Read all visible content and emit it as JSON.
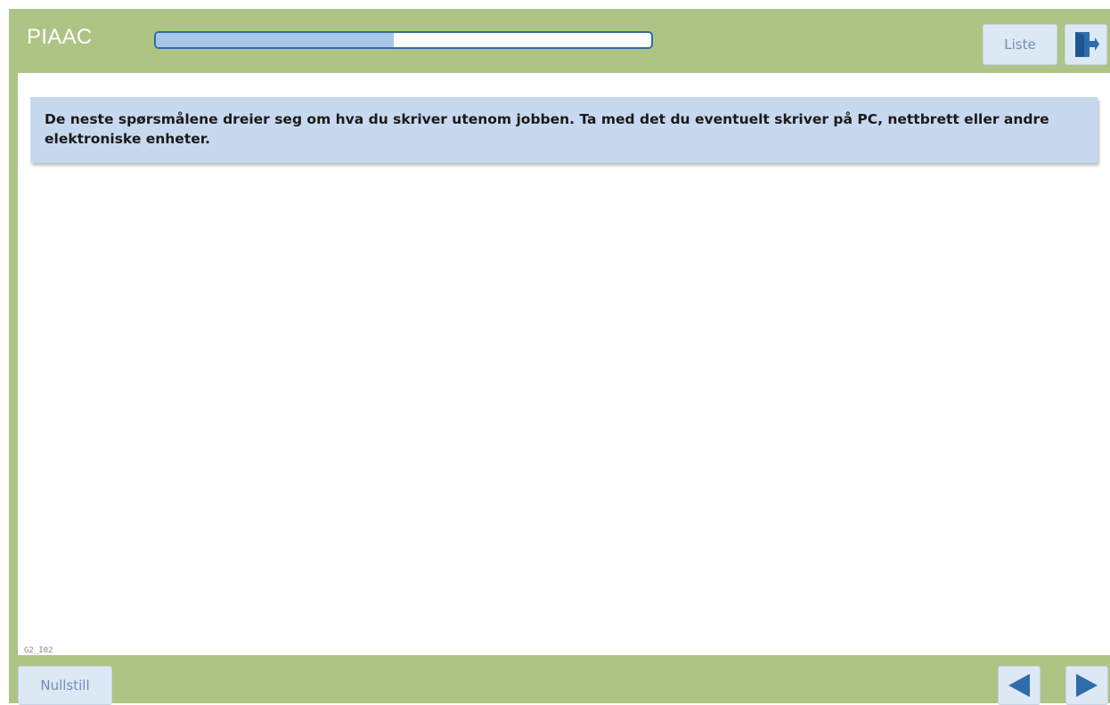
{
  "header": {
    "title": "PIAAC",
    "progress": 0.48,
    "list_label": "Liste",
    "exit_icon": "exit-door-icon"
  },
  "main": {
    "info_text": "De neste spørsmålene dreier seg om hva du skriver utenom jobben. Ta med det du eventuelt skriver på PC, nettbrett eller andre elektroniske enheter.",
    "page_code": "G2_I02"
  },
  "footer": {
    "reset_label": "Nullstill",
    "back_icon": "triangle-left-icon",
    "next_icon": "triangle-right-icon"
  },
  "colors": {
    "frame": "#adc485",
    "button_bg": "#dde8f5",
    "button_text": "#6d8fb7",
    "progress_border": "#2f6cab",
    "progress_fill": "#a9c6e6",
    "info_box": "#c7d9ef",
    "icon_blue": "#2f6cab"
  }
}
